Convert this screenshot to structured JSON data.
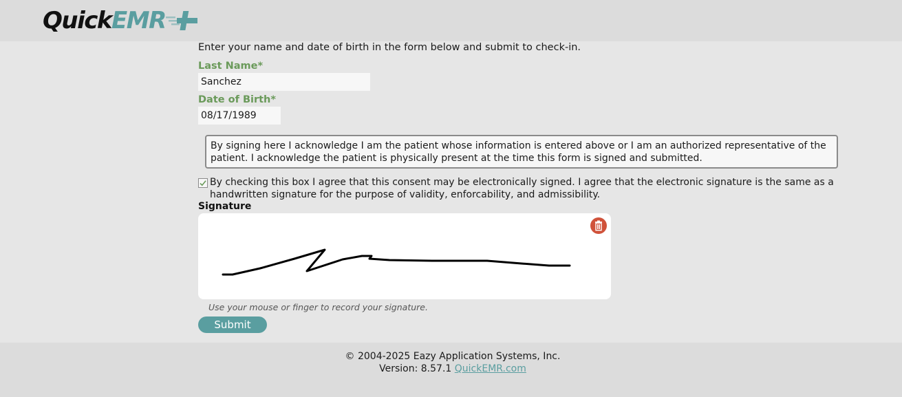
{
  "header": {
    "logo_quick": "Quick",
    "logo_emr": "EMR",
    "colors": {
      "brand_dark": "#111111",
      "brand_teal": "#5a9ea0",
      "header_bg": "#dcdcdc"
    }
  },
  "form": {
    "intro": "Enter your name and date of birth in the form below and submit to check-in.",
    "last_name_label": "Last Name*",
    "last_name_value": "Sanchez",
    "dob_label": "Date of Birth*",
    "dob_value": "08/17/1989",
    "acknowledgement": "By signing here I acknowledge I am the patient whose information is entered above or I am an authorized representative of the patient. I acknowledge the patient is physically present at the time this form is signed and submitted.",
    "consent_checked": true,
    "consent_text": "By checking this box I agree that this consent may be electronically signed. I agree that the electronic signature is the same as a handwritten signature for the purpose of validity, enforcability, and admissibility.",
    "signature_label": "Signature",
    "signature_hint": "Use your mouse or finger to record your signature.",
    "clear_signature_icon": "trash-icon",
    "submit_label": "Submit",
    "colors": {
      "label_green": "#6a9a5a",
      "submit_teal": "#5a9ea0",
      "trash_red": "#d0523a"
    }
  },
  "footer": {
    "copyright": "© 2004-2025 Eazy Application Systems, Inc.",
    "version_prefix": "Version: 8.57.1",
    "link_text": "QuickEMR.com"
  }
}
